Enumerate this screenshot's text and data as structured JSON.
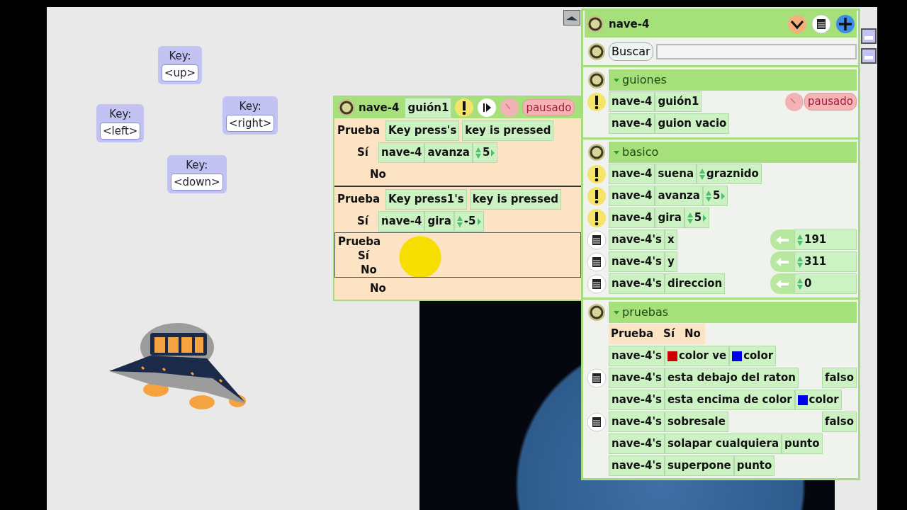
{
  "keys": [
    {
      "label": "Key:",
      "value": "<up>"
    },
    {
      "label": "Key:",
      "value": "<left>"
    },
    {
      "label": "Key:",
      "value": "<right>"
    },
    {
      "label": "Key:",
      "value": "<down>"
    }
  ],
  "script_window": {
    "object": "nave-4",
    "script": "guión1",
    "status": "pausado",
    "tests": [
      {
        "label": "Prueba",
        "condition": [
          {
            "text": "Key press's",
            "kind": "word"
          },
          {
            "text": "key is pressed",
            "kind": "word"
          }
        ],
        "yes_label": "Sí",
        "yes": [
          {
            "text": "nave-4",
            "kind": "word"
          },
          {
            "text": "avanza",
            "kind": "word"
          },
          {
            "text": "5",
            "kind": "number"
          }
        ],
        "no_label": "No"
      },
      {
        "label": "Prueba",
        "condition": [
          {
            "text": "Key press1's",
            "kind": "word"
          },
          {
            "text": "key is pressed",
            "kind": "word"
          }
        ],
        "yes_label": "Sí",
        "yes": [
          {
            "text": "nave-4",
            "kind": "word"
          },
          {
            "text": "gira",
            "kind": "word"
          },
          {
            "text": "-5",
            "kind": "number"
          }
        ],
        "no_label": "No"
      }
    ]
  },
  "floating_test": {
    "labels": [
      "Prueba",
      "Sí",
      "No"
    ]
  },
  "viewer": {
    "title": "nave-4",
    "search_button": "Buscar",
    "categories": [
      {
        "name": "guiones",
        "expanded": true,
        "rows": [
          {
            "kind": "script",
            "tiles": [
              {
                "text": "nave-4",
                "kind": "word"
              },
              {
                "text": "guión1",
                "kind": "word"
              }
            ],
            "status": "pausado"
          },
          {
            "kind": "plain",
            "tiles": [
              {
                "text": "nave-4",
                "kind": "word"
              },
              {
                "text": "guion vacio",
                "kind": "word"
              }
            ]
          }
        ]
      },
      {
        "name": "basico",
        "expanded": true,
        "rows": [
          {
            "kind": "command",
            "tiles": [
              {
                "text": "nave-4",
                "kind": "word"
              },
              {
                "text": "suena",
                "kind": "word"
              },
              {
                "text": "graznido",
                "kind": "choice"
              }
            ]
          },
          {
            "kind": "command",
            "tiles": [
              {
                "text": "nave-4",
                "kind": "word"
              },
              {
                "text": "avanza",
                "kind": "word"
              },
              {
                "text": "5",
                "kind": "number"
              }
            ]
          },
          {
            "kind": "command",
            "tiles": [
              {
                "text": "nave-4",
                "kind": "word"
              },
              {
                "text": "gira",
                "kind": "word"
              },
              {
                "text": "5",
                "kind": "number"
              }
            ]
          },
          {
            "kind": "slot",
            "tiles": [
              {
                "text": "nave-4's",
                "kind": "word"
              },
              {
                "text": "x",
                "kind": "word"
              }
            ],
            "value": "191"
          },
          {
            "kind": "slot",
            "tiles": [
              {
                "text": "nave-4's",
                "kind": "word"
              },
              {
                "text": "y",
                "kind": "word"
              }
            ],
            "value": "311"
          },
          {
            "kind": "slot",
            "tiles": [
              {
                "text": "nave-4's",
                "kind": "word"
              },
              {
                "text": "direccion",
                "kind": "word"
              }
            ],
            "value": "0"
          }
        ]
      },
      {
        "name": "pruebas",
        "expanded": true,
        "rows": [
          {
            "kind": "test-tile",
            "labels": [
              "Prueba",
              "Sí",
              "No"
            ]
          },
          {
            "kind": "plain",
            "tiles": [
              {
                "text": "nave-4's",
                "kind": "word"
              },
              {
                "text": "color ve",
                "kind": "color",
                "color": "#cc0000"
              },
              {
                "text": "color",
                "kind": "color",
                "color": "#0000ee"
              }
            ]
          },
          {
            "kind": "readout",
            "tiles": [
              {
                "text": "nave-4's",
                "kind": "word"
              },
              {
                "text": "esta debajo del raton",
                "kind": "word"
              }
            ],
            "value": "falso"
          },
          {
            "kind": "plain",
            "tiles": [
              {
                "text": "nave-4's",
                "kind": "word"
              },
              {
                "text": "esta encima de color",
                "kind": "word"
              },
              {
                "text": "color",
                "kind": "color",
                "color": "#0000ee"
              }
            ]
          },
          {
            "kind": "readout",
            "tiles": [
              {
                "text": "nave-4's",
                "kind": "word"
              },
              {
                "text": "sobresale",
                "kind": "word"
              }
            ],
            "value": "falso"
          },
          {
            "kind": "plain",
            "tiles": [
              {
                "text": "nave-4's",
                "kind": "word"
              },
              {
                "text": "solapar cualquiera",
                "kind": "word"
              },
              {
                "text": "punto",
                "kind": "word"
              }
            ]
          },
          {
            "kind": "plain",
            "tiles": [
              {
                "text": "nave-4's",
                "kind": "word"
              },
              {
                "text": "superpone",
                "kind": "word"
              },
              {
                "text": "punto",
                "kind": "word"
              }
            ]
          }
        ]
      }
    ]
  }
}
